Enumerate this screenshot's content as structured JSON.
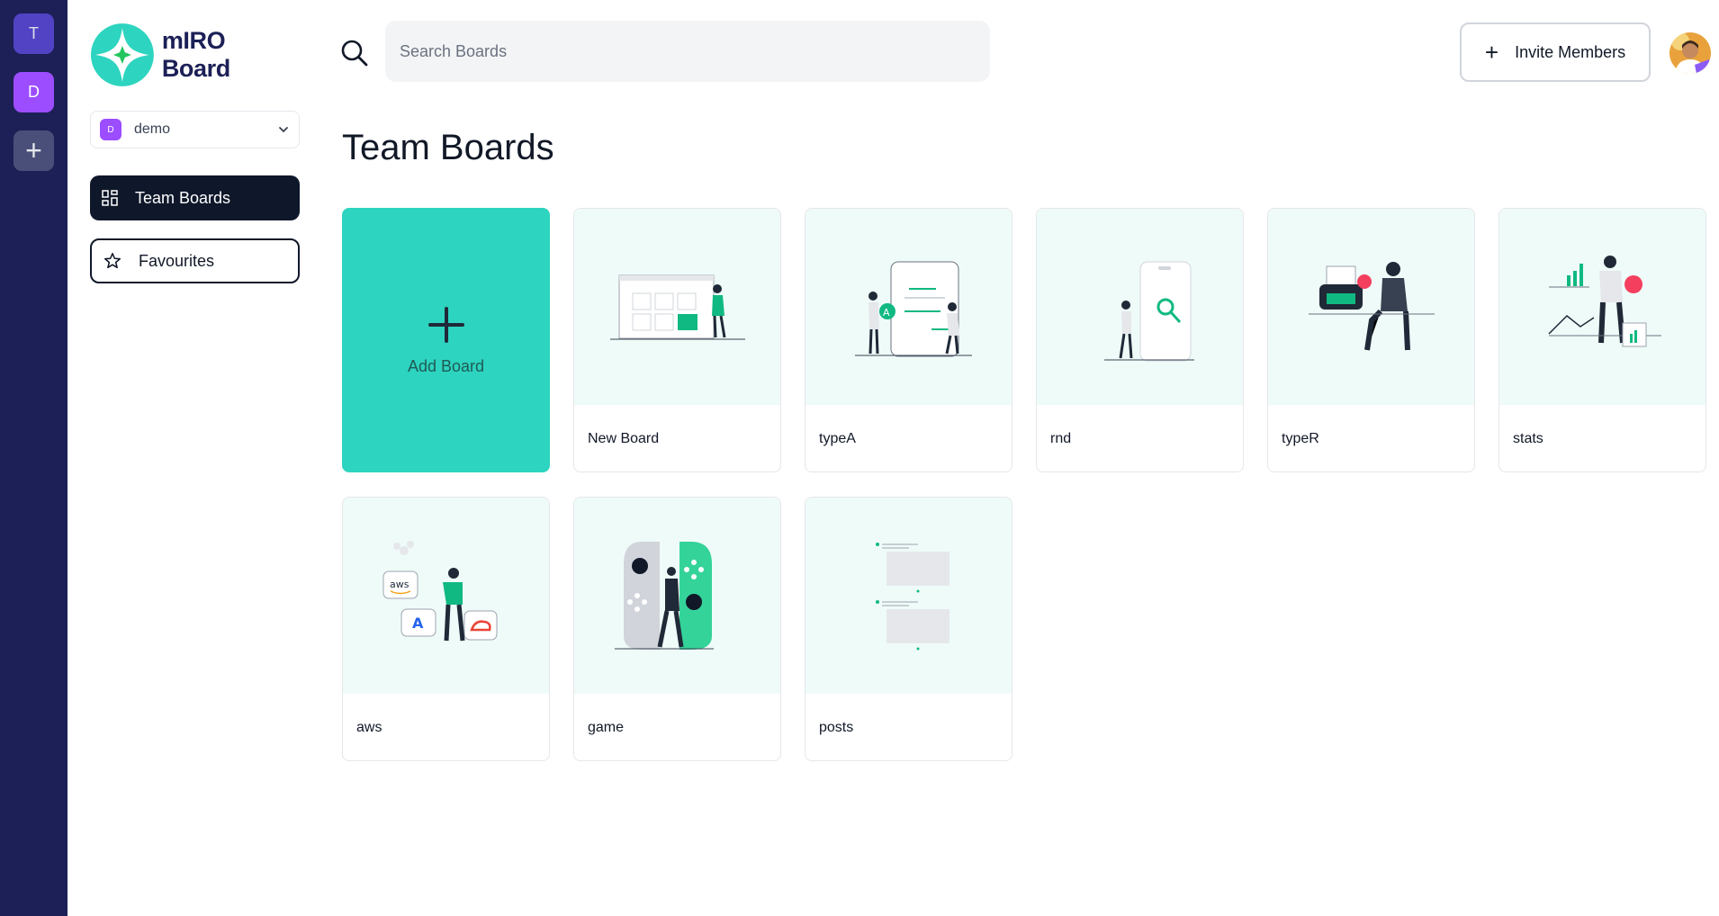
{
  "rail": {
    "orgs": [
      {
        "initial": "T",
        "color": "#5b4ad8"
      },
      {
        "initial": "D",
        "color": "#9b4dff"
      }
    ],
    "add_icon": "plus-icon"
  },
  "brand": {
    "name": "mIRO Board",
    "accent": "#2dd4bf"
  },
  "org_select": {
    "chip": "D",
    "name": "demo"
  },
  "nav": {
    "team_boards": {
      "label": "Team Boards",
      "icon": "grid-icon"
    },
    "favourites": {
      "label": "Favourites",
      "icon": "star-icon"
    }
  },
  "search": {
    "placeholder": "Search Boards",
    "value": ""
  },
  "header": {
    "invite_label": "Invite Members"
  },
  "main": {
    "title": "Team Boards",
    "add_board_label": "Add Board",
    "boards": [
      {
        "title": "New Board"
      },
      {
        "title": "typeA"
      },
      {
        "title": "rnd"
      },
      {
        "title": "typeR"
      },
      {
        "title": "stats"
      },
      {
        "title": "aws"
      },
      {
        "title": "game"
      },
      {
        "title": "posts"
      }
    ]
  },
  "colors": {
    "rail": "#1c2056",
    "accent": "#2dd4bf",
    "dark": "#0f172a",
    "thumb_bg": "#effbf8"
  }
}
